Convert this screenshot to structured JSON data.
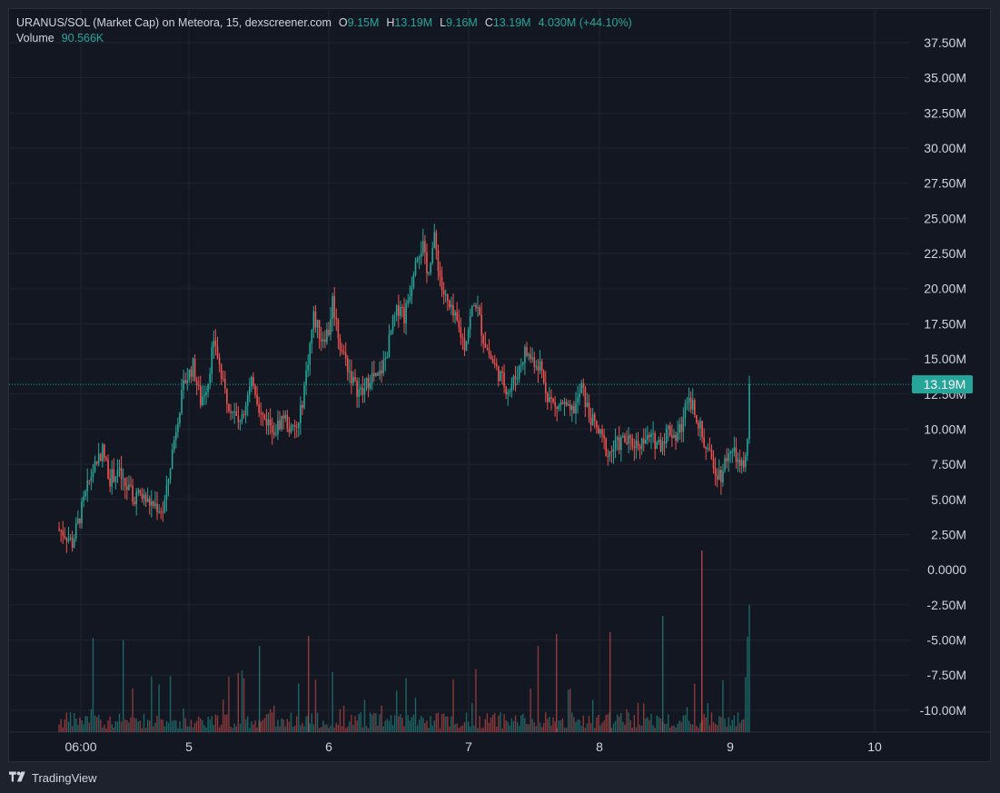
{
  "legend": {
    "symbol": "URANUS/SOL (Market Cap) on Meteora, 15, dexscreener.com",
    "o_key": "O",
    "o_val": "9.15M",
    "h_key": "H",
    "h_val": "13.19M",
    "l_key": "L",
    "l_val": "9.16M",
    "c_key": "C",
    "c_val": "13.19M",
    "change": "4.030M (+44.10%)",
    "volume_label": "Volume",
    "volume_value": "90.566K"
  },
  "price_badge": "13.19M",
  "footer": {
    "brand": "TradingView"
  },
  "colors": {
    "up": "#26a69a",
    "down": "#ef5350",
    "background": "#131722",
    "grid": "#1f2430",
    "text": "#d1d4dc"
  },
  "chart_data": {
    "type": "candlestick",
    "y_axis_ticks": [
      "37.50M",
      "35.00M",
      "32.50M",
      "30.00M",
      "27.50M",
      "25.00M",
      "22.50M",
      "20.00M",
      "17.50M",
      "15.00M",
      "12.50M",
      "10.00M",
      "7.50M",
      "5.00M",
      "2.50M",
      "0.0000",
      "-2.50M",
      "-5.00M",
      "-7.50M",
      "-10.00M"
    ],
    "x_axis_ticks": [
      "06:00",
      "5",
      "6",
      "7",
      "8",
      "9",
      "10"
    ],
    "ylim_millions": [
      -11,
      38.5
    ],
    "last_price_millions": 13.19,
    "price_path_millions": [
      [
        0,
        2.9
      ],
      [
        4,
        2.6
      ],
      [
        8,
        1.9
      ],
      [
        12,
        3.8
      ],
      [
        16,
        5.8
      ],
      [
        20,
        7.6
      ],
      [
        24,
        8.5
      ],
      [
        28,
        6.5
      ],
      [
        32,
        7.0
      ],
      [
        36,
        6.0
      ],
      [
        40,
        5.2
      ],
      [
        44,
        5.3
      ],
      [
        48,
        4.8
      ],
      [
        52,
        4.6
      ],
      [
        56,
        4.2
      ],
      [
        58,
        5.5
      ],
      [
        60,
        7.5
      ],
      [
        64,
        11.0
      ],
      [
        68,
        13.5
      ],
      [
        72,
        14.5
      ],
      [
        76,
        12.0
      ],
      [
        80,
        13.5
      ],
      [
        82,
        15.5
      ],
      [
        84,
        16.0
      ],
      [
        88,
        13.0
      ],
      [
        92,
        11.5
      ],
      [
        96,
        10.5
      ],
      [
        100,
        12.0
      ],
      [
        104,
        13.5
      ],
      [
        108,
        11.0
      ],
      [
        112,
        10.5
      ],
      [
        116,
        10.0
      ],
      [
        120,
        11.0
      ],
      [
        124,
        9.8
      ],
      [
        128,
        10.2
      ],
      [
        132,
        14.0
      ],
      [
        136,
        18.0
      ],
      [
        140,
        16.5
      ],
      [
        144,
        17.0
      ],
      [
        146,
        19.2
      ],
      [
        150,
        16.0
      ],
      [
        154,
        14.5
      ],
      [
        158,
        13.0
      ],
      [
        162,
        12.5
      ],
      [
        166,
        13.8
      ],
      [
        170,
        13.5
      ],
      [
        174,
        15.0
      ],
      [
        178,
        17.5
      ],
      [
        182,
        19.0
      ],
      [
        184,
        18.0
      ],
      [
        188,
        20.5
      ],
      [
        190,
        22.5
      ],
      [
        194,
        23.0
      ],
      [
        196,
        21.0
      ],
      [
        200,
        23.5
      ],
      [
        204,
        20.0
      ],
      [
        208,
        18.5
      ],
      [
        212,
        17.5
      ],
      [
        216,
        16.0
      ],
      [
        220,
        18.5
      ],
      [
        222,
        19.0
      ],
      [
        226,
        16.5
      ],
      [
        230,
        15.0
      ],
      [
        234,
        14.0
      ],
      [
        238,
        13.0
      ],
      [
        240,
        12.8
      ],
      [
        244,
        14.0
      ],
      [
        248,
        15.5
      ],
      [
        252,
        15.0
      ],
      [
        256,
        14.5
      ],
      [
        260,
        12.5
      ],
      [
        264,
        11.5
      ],
      [
        268,
        11.8
      ],
      [
        272,
        11.0
      ],
      [
        276,
        12.0
      ],
      [
        278,
        13.0
      ],
      [
        282,
        11.0
      ],
      [
        286,
        10.0
      ],
      [
        290,
        9.0
      ],
      [
        292,
        8.2
      ],
      [
        296,
        8.8
      ],
      [
        300,
        9.2
      ],
      [
        304,
        9.0
      ],
      [
        308,
        9.0
      ],
      [
        312,
        9.3
      ],
      [
        316,
        9.2
      ],
      [
        320,
        9.0
      ],
      [
        324,
        10.0
      ],
      [
        328,
        9.5
      ],
      [
        332,
        10.5
      ],
      [
        334,
        12.5
      ],
      [
        338,
        11.5
      ],
      [
        342,
        9.5
      ],
      [
        346,
        8.0
      ],
      [
        350,
        7.0
      ],
      [
        352,
        6.8
      ],
      [
        356,
        8.5
      ],
      [
        360,
        8.0
      ],
      [
        362,
        7.2
      ],
      [
        364,
        7.3
      ],
      [
        366,
        9.15
      ],
      [
        367,
        13.19
      ]
    ]
  }
}
